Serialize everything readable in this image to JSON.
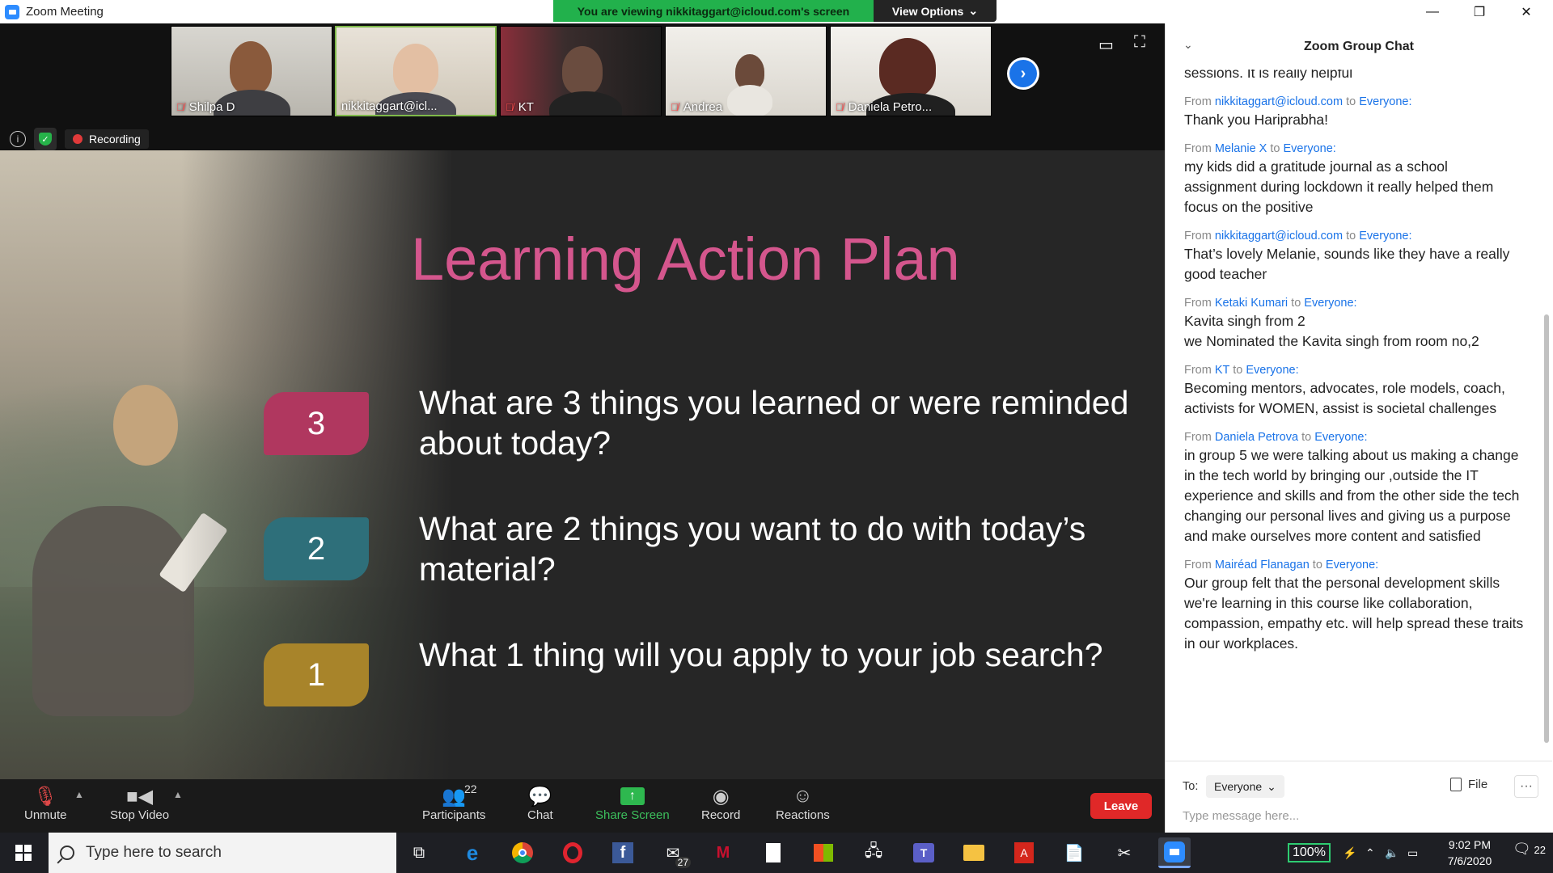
{
  "window": {
    "title": "Zoom Meeting",
    "viewing_banner": "You are viewing nikkitaggart@icloud.com's screen",
    "view_options": "View Options"
  },
  "participants": [
    {
      "name": "Shilpa D",
      "muted": true
    },
    {
      "name": "nikkitaggart@icl...",
      "muted": false
    },
    {
      "name": "KT",
      "muted": true
    },
    {
      "name": "Andrea",
      "muted": true
    },
    {
      "name": "Daniela Petro...",
      "muted": true
    }
  ],
  "status": {
    "recording": "Recording"
  },
  "slide": {
    "title": "Learning Action Plan",
    "items": [
      {
        "number": "3",
        "text": "What are 3 things you learned or were reminded about today?",
        "color": "#b0375f"
      },
      {
        "number": "2",
        "text": "What are 2 things you want to do with today’s material?",
        "color": "#2e6f7a"
      },
      {
        "number": "1",
        "text": "What 1 thing will you apply to your job search?",
        "color": "#a8842a"
      }
    ]
  },
  "toolbar": {
    "unmute": "Unmute",
    "stop_video": "Stop Video",
    "participants": "Participants",
    "participants_count": "22",
    "chat": "Chat",
    "share_screen": "Share Screen",
    "record": "Record",
    "reactions": "Reactions",
    "leave": "Leave"
  },
  "chat": {
    "title": "Zoom Group Chat",
    "partial_top": "sessions. It is really helpful",
    "from_label": "From",
    "to_label": "to",
    "messages": [
      {
        "from": "nikkitaggart@icloud.com",
        "to": "Everyone:",
        "lines": [
          "Thank you Hariprabha!"
        ]
      },
      {
        "from": "Melanie X",
        "to": "Everyone:",
        "lines": [
          "my kids did a gratitude journal as a  school assignment during lockdown it really helped them focus on the positive"
        ]
      },
      {
        "from": "nikkitaggart@icloud.com",
        "to": "Everyone:",
        "lines": [
          "That’s lovely Melanie, sounds like they have a really good teacher"
        ]
      },
      {
        "from": "Ketaki Kumari",
        "to": "Everyone:",
        "lines": [
          "Kavita singh from 2",
          "we Nominated the Kavita singh from room no,2"
        ]
      },
      {
        "from": "KT",
        "to": "Everyone:",
        "lines": [
          "Becoming mentors, advocates, role models, coach, activists for WOMEN, assist is societal challenges"
        ]
      },
      {
        "from": "Daniela Petrova",
        "to": "Everyone:",
        "lines": [
          "in group 5 we were talking about us making a change in the tech world by bringing our ,outside the IT experience and skills and from the other side the tech changing our personal lives and giving us a purpose and make ourselves more content and satisfied"
        ]
      },
      {
        "from": "Mairéad Flanagan",
        "to": "Everyone:",
        "lines": [
          "Our group felt that the personal development skills we're learning in this course like collaboration, compassion, empathy etc. will help spread these traits in our workplaces."
        ]
      }
    ],
    "to_prefix": "To:",
    "recipient": "Everyone",
    "file": "File",
    "input_placeholder": "Type message here..."
  },
  "taskbar": {
    "search_placeholder": "Type here to search",
    "mail_badge": "27",
    "battery": "100%",
    "time": "9:02 PM",
    "date": "7/6/2020",
    "notifications": "22"
  }
}
